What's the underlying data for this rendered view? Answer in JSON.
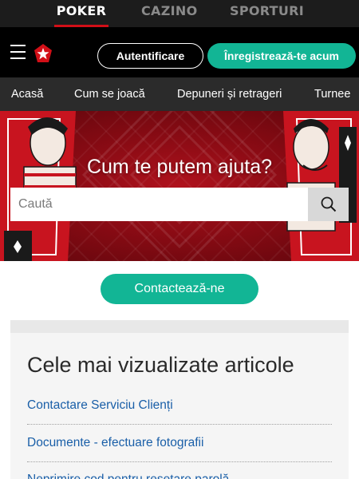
{
  "product_tabs": [
    "POKER",
    "CAZINO",
    "SPORTURI"
  ],
  "header": {
    "login_label": "Autentificare",
    "register_label": "Înregistrează-te acum"
  },
  "subnav": [
    "Acasă",
    "Cum se joacă",
    "Depuneri și retrageri",
    "Turnee"
  ],
  "hero": {
    "title": "Cum te putem ajuta?",
    "search_placeholder": "Caută"
  },
  "contact": {
    "label": "Contactează-ne"
  },
  "articles": {
    "title": "Cele mai vizualizate articole",
    "items": [
      "Contactare Serviciu Clienți",
      "Documente - efectuare fotografii",
      "Neprimire cod pentru resetare parolă"
    ]
  },
  "colors": {
    "accent_green": "#12b595",
    "brand_red": "#d20f17",
    "link_blue": "#1a5fa8"
  }
}
